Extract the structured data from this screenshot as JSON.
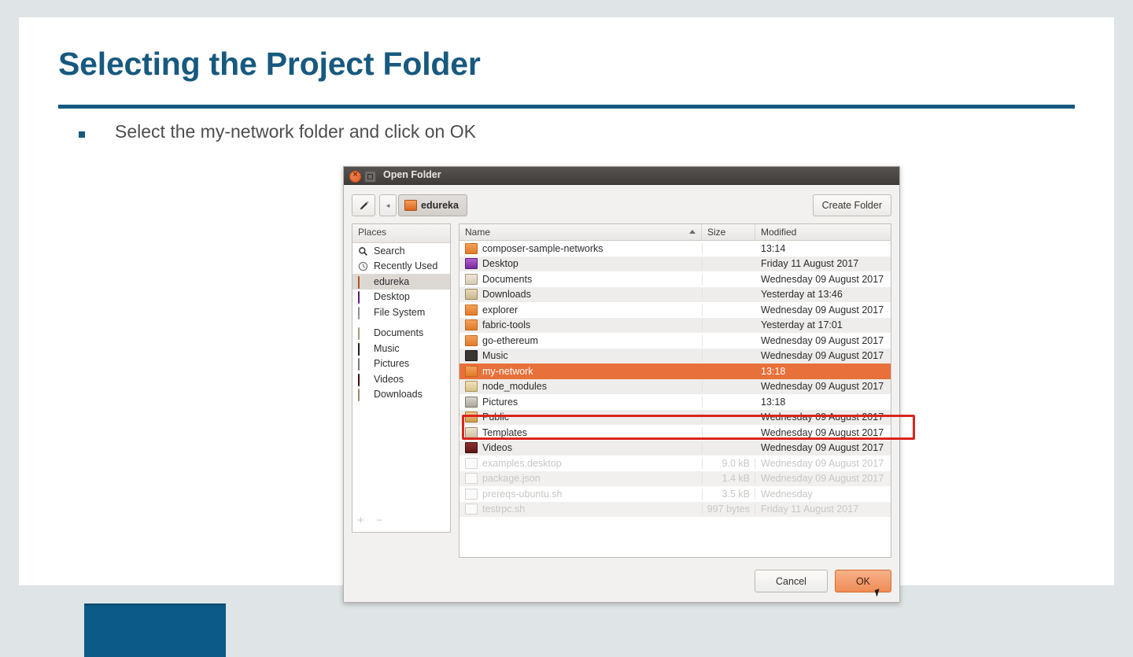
{
  "slide": {
    "title": "Selecting the Project Folder",
    "bullet": "Select the my-network folder and click on OK",
    "accent_color": "#17597f",
    "corner_block_color": "#0b5a87"
  },
  "dialog": {
    "window_title": "Open Folder",
    "window_buttons": {
      "close": "close-button",
      "maximize": "maximize-button"
    },
    "toolbar": {
      "pencil_icon": "pencil-icon",
      "back_label": "◂",
      "breadcrumb": "edureka",
      "create_folder_label": "Create Folder"
    },
    "places": {
      "header": "Places",
      "items": [
        {
          "label": "Search",
          "icon": "search-icon",
          "selected": false,
          "gap": false
        },
        {
          "label": "Recently Used",
          "icon": "recent-icon",
          "selected": false,
          "gap": false
        },
        {
          "label": "edureka",
          "icon": "home-icon",
          "selected": true,
          "gap": false
        },
        {
          "label": "Desktop",
          "icon": "desktop-icon",
          "selected": false,
          "gap": false
        },
        {
          "label": "File System",
          "icon": "file-system-icon",
          "selected": false,
          "gap": false
        },
        {
          "label": "Documents",
          "icon": "documents-icon",
          "selected": false,
          "gap": true
        },
        {
          "label": "Music",
          "icon": "music-icon",
          "selected": false,
          "gap": false
        },
        {
          "label": "Pictures",
          "icon": "pictures-icon",
          "selected": false,
          "gap": false
        },
        {
          "label": "Videos",
          "icon": "videos-icon",
          "selected": false,
          "gap": false
        },
        {
          "label": "Downloads",
          "icon": "downloads-icon",
          "selected": false,
          "gap": false
        }
      ],
      "add_label": "+",
      "remove_label": "−"
    },
    "columns": {
      "name": "Name",
      "size": "Size",
      "modified": "Modified",
      "sorted_by": "Name",
      "sort_direction": "ascending"
    },
    "files": [
      {
        "name": "composer-sample-networks",
        "size": "",
        "modified": "13:14",
        "icon": "folder",
        "state": "normal"
      },
      {
        "name": "Desktop",
        "size": "",
        "modified": "Friday 11 August 2017",
        "icon": "desktop",
        "state": "normal"
      },
      {
        "name": "Documents",
        "size": "",
        "modified": "Wednesday 09 August 2017",
        "icon": "docs",
        "state": "normal"
      },
      {
        "name": "Downloads",
        "size": "",
        "modified": "Yesterday at 13:46",
        "icon": "dl",
        "state": "normal"
      },
      {
        "name": "explorer",
        "size": "",
        "modified": "Wednesday 09 August 2017",
        "icon": "folder",
        "state": "normal"
      },
      {
        "name": "fabric-tools",
        "size": "",
        "modified": "Yesterday at 17:01",
        "icon": "folder",
        "state": "normal"
      },
      {
        "name": "go-ethereum",
        "size": "",
        "modified": "Wednesday 09 August 2017",
        "icon": "folder",
        "state": "normal"
      },
      {
        "name": "Music",
        "size": "",
        "modified": "Wednesday 09 August 2017",
        "icon": "music",
        "state": "normal"
      },
      {
        "name": "my-network",
        "size": "",
        "modified": "13:18",
        "icon": "folder",
        "state": "selected"
      },
      {
        "name": "node_modules",
        "size": "",
        "modified": "Wednesday 09 August 2017",
        "icon": "node",
        "state": "normal"
      },
      {
        "name": "Pictures",
        "size": "",
        "modified": "13:18",
        "icon": "pics",
        "state": "normal"
      },
      {
        "name": "Public",
        "size": "",
        "modified": "Wednesday 09 August 2017",
        "icon": "pub",
        "state": "normal"
      },
      {
        "name": "Templates",
        "size": "",
        "modified": "Wednesday 09 August 2017",
        "icon": "tmpl",
        "state": "normal"
      },
      {
        "name": "Videos",
        "size": "",
        "modified": "Wednesday 09 August 2017",
        "icon": "vid",
        "state": "normal"
      },
      {
        "name": "examples.desktop",
        "size": "9.0 kB",
        "modified": "Wednesday 09 August 2017",
        "icon": "file",
        "state": "dim"
      },
      {
        "name": "package.json",
        "size": "1.4 kB",
        "modified": "Wednesday 09 August 2017",
        "icon": "file",
        "state": "dim"
      },
      {
        "name": "prereqs-ubuntu.sh",
        "size": "3.5 kB",
        "modified": "Wednesday",
        "icon": "file",
        "state": "dim"
      },
      {
        "name": "testrpc.sh",
        "size": "997 bytes",
        "modified": "Friday 11 August 2017",
        "icon": "file",
        "state": "dim"
      }
    ],
    "actions": {
      "cancel_label": "Cancel",
      "ok_label": "OK"
    },
    "selection_color": "#e8703a",
    "annotation_color": "#d9251d"
  }
}
